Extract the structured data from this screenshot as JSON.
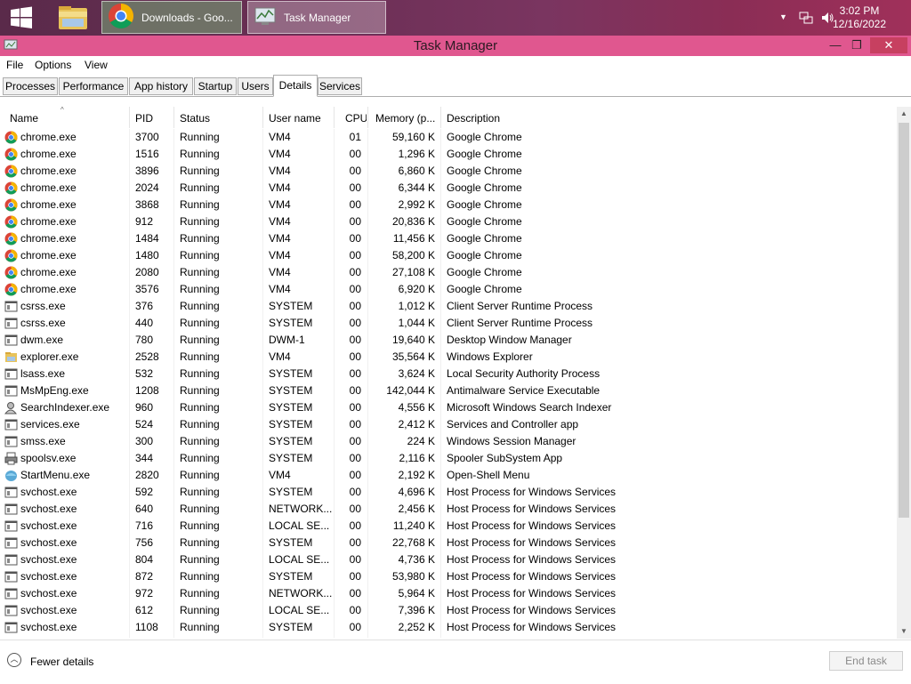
{
  "taskbar": {
    "chrome_button_label": "Downloads - Goo...",
    "taskmgr_button_label": "Task Manager",
    "time": "3:02 PM",
    "date": "12/16/2022"
  },
  "window": {
    "title": "Task Manager",
    "minimize": "—",
    "maximize": "❐",
    "close": "✕"
  },
  "menu": [
    "File",
    "Options",
    "View"
  ],
  "tabs": [
    "Processes",
    "Performance",
    "App history",
    "Startup",
    "Users",
    "Details",
    "Services"
  ],
  "active_tab": "Details",
  "columns": [
    "Name",
    "PID",
    "Status",
    "User name",
    "CPU",
    "Memory (p...",
    "Description"
  ],
  "rows": [
    {
      "icon": "chrome",
      "name": "chrome.exe",
      "pid": "3700",
      "status": "Running",
      "user": "VM4",
      "cpu": "01",
      "mem": "59,160 K",
      "desc": "Google Chrome"
    },
    {
      "icon": "chrome",
      "name": "chrome.exe",
      "pid": "1516",
      "status": "Running",
      "user": "VM4",
      "cpu": "00",
      "mem": "1,296 K",
      "desc": "Google Chrome"
    },
    {
      "icon": "chrome",
      "name": "chrome.exe",
      "pid": "3896",
      "status": "Running",
      "user": "VM4",
      "cpu": "00",
      "mem": "6,860 K",
      "desc": "Google Chrome"
    },
    {
      "icon": "chrome",
      "name": "chrome.exe",
      "pid": "2024",
      "status": "Running",
      "user": "VM4",
      "cpu": "00",
      "mem": "6,344 K",
      "desc": "Google Chrome"
    },
    {
      "icon": "chrome",
      "name": "chrome.exe",
      "pid": "3868",
      "status": "Running",
      "user": "VM4",
      "cpu": "00",
      "mem": "2,992 K",
      "desc": "Google Chrome"
    },
    {
      "icon": "chrome",
      "name": "chrome.exe",
      "pid": "912",
      "status": "Running",
      "user": "VM4",
      "cpu": "00",
      "mem": "20,836 K",
      "desc": "Google Chrome"
    },
    {
      "icon": "chrome",
      "name": "chrome.exe",
      "pid": "1484",
      "status": "Running",
      "user": "VM4",
      "cpu": "00",
      "mem": "11,456 K",
      "desc": "Google Chrome"
    },
    {
      "icon": "chrome",
      "name": "chrome.exe",
      "pid": "1480",
      "status": "Running",
      "user": "VM4",
      "cpu": "00",
      "mem": "58,200 K",
      "desc": "Google Chrome"
    },
    {
      "icon": "chrome",
      "name": "chrome.exe",
      "pid": "2080",
      "status": "Running",
      "user": "VM4",
      "cpu": "00",
      "mem": "27,108 K",
      "desc": "Google Chrome"
    },
    {
      "icon": "chrome",
      "name": "chrome.exe",
      "pid": "3576",
      "status": "Running",
      "user": "VM4",
      "cpu": "00",
      "mem": "6,920 K",
      "desc": "Google Chrome"
    },
    {
      "icon": "window",
      "name": "csrss.exe",
      "pid": "376",
      "status": "Running",
      "user": "SYSTEM",
      "cpu": "00",
      "mem": "1,012 K",
      "desc": "Client Server Runtime Process"
    },
    {
      "icon": "window",
      "name": "csrss.exe",
      "pid": "440",
      "status": "Running",
      "user": "SYSTEM",
      "cpu": "00",
      "mem": "1,044 K",
      "desc": "Client Server Runtime Process"
    },
    {
      "icon": "window",
      "name": "dwm.exe",
      "pid": "780",
      "status": "Running",
      "user": "DWM-1",
      "cpu": "00",
      "mem": "19,640 K",
      "desc": "Desktop Window Manager"
    },
    {
      "icon": "folder",
      "name": "explorer.exe",
      "pid": "2528",
      "status": "Running",
      "user": "VM4",
      "cpu": "00",
      "mem": "35,564 K",
      "desc": "Windows Explorer"
    },
    {
      "icon": "window",
      "name": "lsass.exe",
      "pid": "532",
      "status": "Running",
      "user": "SYSTEM",
      "cpu": "00",
      "mem": "3,624 K",
      "desc": "Local Security Authority Process"
    },
    {
      "icon": "window",
      "name": "MsMpEng.exe",
      "pid": "1208",
      "status": "Running",
      "user": "SYSTEM",
      "cpu": "00",
      "mem": "142,044 K",
      "desc": "Antimalware Service Executable"
    },
    {
      "icon": "person",
      "name": "SearchIndexer.exe",
      "pid": "960",
      "status": "Running",
      "user": "SYSTEM",
      "cpu": "00",
      "mem": "4,556 K",
      "desc": "Microsoft Windows Search Indexer"
    },
    {
      "icon": "window",
      "name": "services.exe",
      "pid": "524",
      "status": "Running",
      "user": "SYSTEM",
      "cpu": "00",
      "mem": "2,412 K",
      "desc": "Services and Controller app"
    },
    {
      "icon": "window",
      "name": "smss.exe",
      "pid": "300",
      "status": "Running",
      "user": "SYSTEM",
      "cpu": "00",
      "mem": "224 K",
      "desc": "Windows Session Manager"
    },
    {
      "icon": "printer",
      "name": "spoolsv.exe",
      "pid": "344",
      "status": "Running",
      "user": "SYSTEM",
      "cpu": "00",
      "mem": "2,116 K",
      "desc": "Spooler SubSystem App"
    },
    {
      "icon": "shell",
      "name": "StartMenu.exe",
      "pid": "2820",
      "status": "Running",
      "user": "VM4",
      "cpu": "00",
      "mem": "2,192 K",
      "desc": "Open-Shell Menu"
    },
    {
      "icon": "window",
      "name": "svchost.exe",
      "pid": "592",
      "status": "Running",
      "user": "SYSTEM",
      "cpu": "00",
      "mem": "4,696 K",
      "desc": "Host Process for Windows Services"
    },
    {
      "icon": "window",
      "name": "svchost.exe",
      "pid": "640",
      "status": "Running",
      "user": "NETWORK...",
      "cpu": "00",
      "mem": "2,456 K",
      "desc": "Host Process for Windows Services"
    },
    {
      "icon": "window",
      "name": "svchost.exe",
      "pid": "716",
      "status": "Running",
      "user": "LOCAL SE...",
      "cpu": "00",
      "mem": "11,240 K",
      "desc": "Host Process for Windows Services"
    },
    {
      "icon": "window",
      "name": "svchost.exe",
      "pid": "756",
      "status": "Running",
      "user": "SYSTEM",
      "cpu": "00",
      "mem": "22,768 K",
      "desc": "Host Process for Windows Services"
    },
    {
      "icon": "window",
      "name": "svchost.exe",
      "pid": "804",
      "status": "Running",
      "user": "LOCAL SE...",
      "cpu": "00",
      "mem": "4,736 K",
      "desc": "Host Process for Windows Services"
    },
    {
      "icon": "window",
      "name": "svchost.exe",
      "pid": "872",
      "status": "Running",
      "user": "SYSTEM",
      "cpu": "00",
      "mem": "53,980 K",
      "desc": "Host Process for Windows Services"
    },
    {
      "icon": "window",
      "name": "svchost.exe",
      "pid": "972",
      "status": "Running",
      "user": "NETWORK...",
      "cpu": "00",
      "mem": "5,964 K",
      "desc": "Host Process for Windows Services"
    },
    {
      "icon": "window",
      "name": "svchost.exe",
      "pid": "612",
      "status": "Running",
      "user": "LOCAL SE...",
      "cpu": "00",
      "mem": "7,396 K",
      "desc": "Host Process for Windows Services"
    },
    {
      "icon": "window",
      "name": "svchost.exe",
      "pid": "1108",
      "status": "Running",
      "user": "SYSTEM",
      "cpu": "00",
      "mem": "2,252 K",
      "desc": "Host Process for Windows Services"
    }
  ],
  "footer": {
    "fewer_details": "Fewer details",
    "end_task": "End task"
  }
}
